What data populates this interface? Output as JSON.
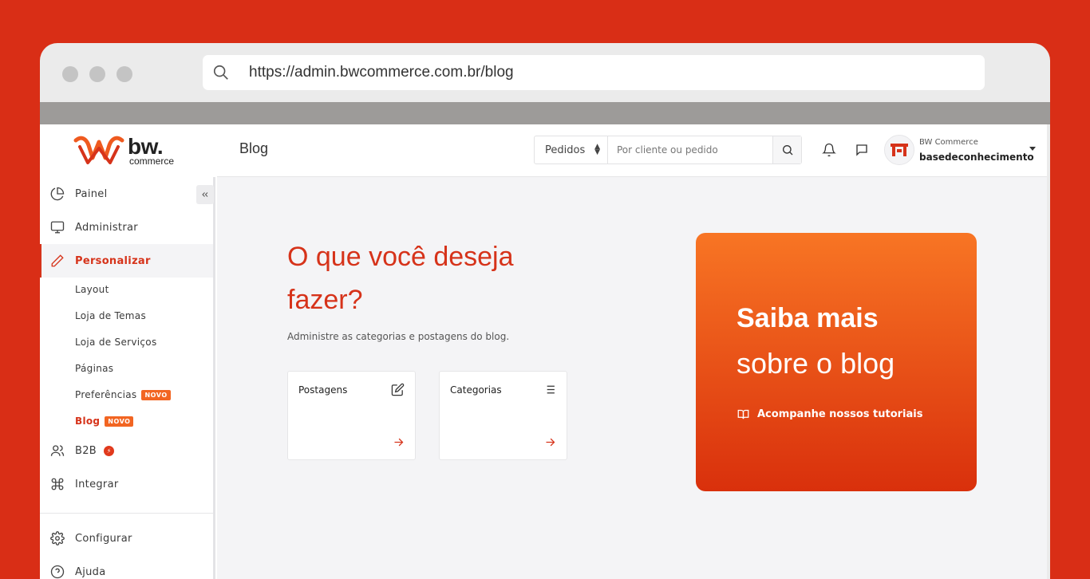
{
  "browser": {
    "url": "https://admin.bwcommerce.com.br/blog"
  },
  "logo": {
    "brand": "bw.",
    "tagline": "commerce"
  },
  "sidebar": {
    "items": [
      {
        "label": "Painel",
        "icon": "pie-chart-icon"
      },
      {
        "label": "Administrar",
        "icon": "monitor-icon"
      },
      {
        "label": "Personalizar",
        "icon": "pencil-icon",
        "active": true
      },
      {
        "label": "B2B",
        "icon": "users-icon",
        "badge_icon": "lightning-icon"
      },
      {
        "label": "Integrar",
        "icon": "command-icon"
      },
      {
        "label": "Configurar",
        "icon": "gear-icon"
      },
      {
        "label": "Ajuda",
        "icon": "help-circle-icon"
      }
    ],
    "subitems": [
      {
        "label": "Layout"
      },
      {
        "label": "Loja de Temas"
      },
      {
        "label": "Loja de Serviços"
      },
      {
        "label": "Páginas"
      },
      {
        "label": "Preferências",
        "badge": "NOVO"
      },
      {
        "label": "Blog",
        "badge": "NOVO",
        "active": true
      }
    ]
  },
  "topbar": {
    "page_title": "Blog",
    "search_type": "Pedidos",
    "search_placeholder": "Por cliente ou pedido",
    "user_company": "BW Commerce",
    "user_name": "basedeconhecimento"
  },
  "main": {
    "headline": "O que você deseja fazer?",
    "subtitle": "Administre as categorias e postagens do blog.",
    "cards": [
      {
        "title": "Postagens",
        "icon": "edit-icon"
      },
      {
        "title": "Categorias",
        "icon": "list-icon"
      }
    ]
  },
  "promo": {
    "title_bold": "Saiba mais",
    "title_regular": "sobre o blog",
    "link": "Acompanhe nossos tutoriais"
  },
  "colors": {
    "background": "#d92e16",
    "accent": "#d6331a",
    "badge": "#f26522",
    "promo_top": "#f87524",
    "promo_bottom": "#d9300c"
  }
}
